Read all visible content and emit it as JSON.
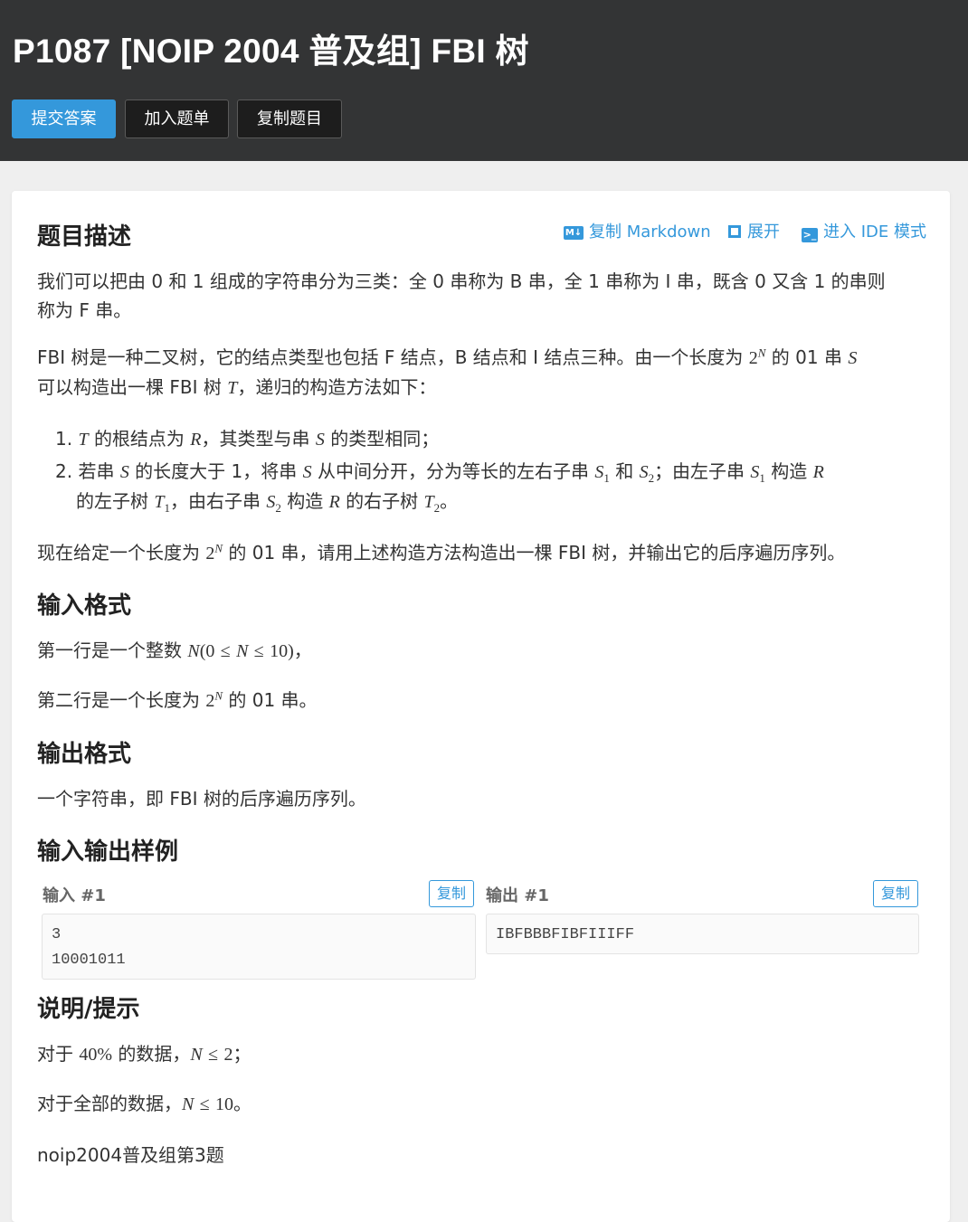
{
  "header": {
    "title": "P1087 [NOIP 2004 普及组] FBI 树",
    "buttons": {
      "submit": "提交答案",
      "add_to_list": "加入题单",
      "copy_problem": "复制题目"
    }
  },
  "toolbar": {
    "copy_markdown": "复制 Markdown",
    "expand": "展开",
    "ide_mode": "进入 IDE 模式",
    "md_badge": "M↓"
  },
  "description": {
    "heading": "题目描述",
    "p1_line1": "我们可以把由 0 和 1 组成的字符串分为三类：全 0 串称为 B 串，全 1 串称为 I 串，既含 0 又含 1 的串则",
    "p1_line2": "称为 F 串。",
    "p2_a": "FBI 树是一种二叉树，它的结点类型也包括 F 结点，B 结点和 I 结点三种。由一个长度为",
    "p2_b": "的 01 串",
    "p2_c": "可以构造出一棵 FBI 树",
    "p2_d": "，递归的构造方法如下：",
    "step1_num": "1.",
    "step1_a": "的根结点为",
    "step1_b": "，其类型与串",
    "step1_c": "的类型相同；",
    "step2_num": "2.",
    "step2_a": "若串",
    "step2_b": "的长度大于 1，将串",
    "step2_c": "从中间分开，分为等长的左右子串",
    "step2_d": "和",
    "step2_e": "；由左子串",
    "step2_f": "构造",
    "step2_g": "的左子树",
    "step2_h": "，由右子串",
    "step2_i": "构造",
    "step2_j": "的右子树",
    "step2_k": "。",
    "p3_a": "现在给定一个长度为",
    "p3_b": "的 01 串，请用上述构造方法构造出一棵 FBI 树，并输出它的后序遍历序列。"
  },
  "math": {
    "two": "2",
    "N": "N",
    "S": "S",
    "T": "T",
    "R": "R",
    "one": "1",
    "subtwo": "2",
    "zero": "0",
    "ten": "10",
    "le": "≤",
    "lparen": "(",
    "rparen": ")",
    "forty": "40%"
  },
  "input_format": {
    "heading": "输入格式",
    "line1_a": "第一行是一个整数",
    "line1_tail": "，",
    "line2_a": "第二行是一个长度为",
    "line2_b": "的 01 串。"
  },
  "output_format": {
    "heading": "输出格式",
    "line1": "一个字符串，即 FBI 树的后序遍历序列。"
  },
  "samples": {
    "heading": "输入输出样例",
    "input_label": "输入 #1",
    "output_label": "输出 #1",
    "copy_label": "复制",
    "input_text": "3\n10001011",
    "output_text": "IBFBBBFIBFIIIFF"
  },
  "hint": {
    "heading": "说明/提示",
    "line1_a": "对于",
    "line1_b": "的数据，",
    "line1_tail": "；",
    "line2_a": "对于全部的数据，",
    "line2_tail": "。",
    "line3": "noip2004普及组第3题"
  },
  "colors": {
    "header_bg": "#333435",
    "primary": "#3498db",
    "page_bg": "#efefef"
  }
}
